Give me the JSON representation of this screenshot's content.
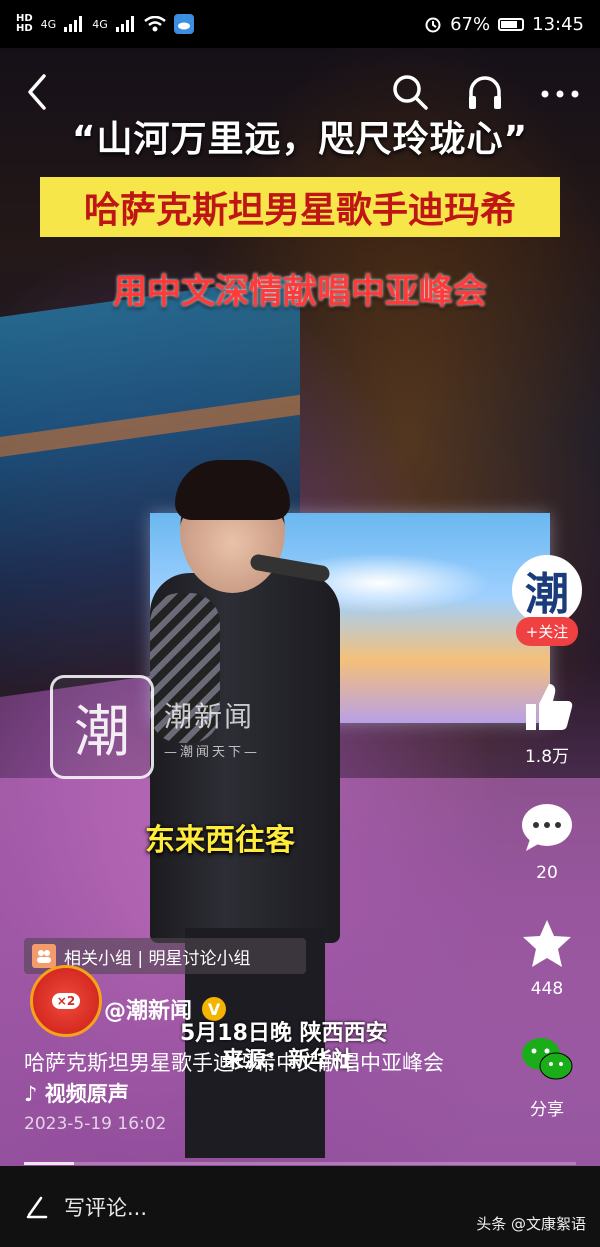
{
  "status_bar": {
    "hd1": "HD",
    "hd2": "HD",
    "signal1": "4G",
    "signal2": "4G",
    "battery": "67%",
    "time": "13:45"
  },
  "video": {
    "quote": "“山河万里远，咫尺玲珑心”",
    "headline": "哈萨克斯坦男星歌手迪玛希",
    "subline": "用中文深情献唱中亚峰会",
    "watermark_logo": "潮",
    "watermark_name": "潮新闻",
    "watermark_slogan": "—潮闻天下—",
    "caption_yellow": "东来西往客",
    "caption_white_1": "5月18日晚 陕西西安",
    "caption_white_2": "来源：新华社"
  },
  "side": {
    "avatar_text": "潮",
    "follow_label": "+关注",
    "like_count": "1.8万",
    "comment_count": "20",
    "favorite_count": "448",
    "share_label": "分享"
  },
  "info": {
    "group_label": "相关小组 | 明星讨论小组",
    "redpack_badge": "×2",
    "author_name": "@潮新闻",
    "description": "哈萨克斯坦男星歌手迪玛希中文献唱中亚峰会",
    "music_label": "♪ 视频原声",
    "date": "2023-5-19 16:02",
    "progress": 0.09
  },
  "bottom": {
    "comment_placeholder": "写评论...",
    "source_watermark": "头条 @文康絮语"
  },
  "colors": {
    "headline_bg": "#f7e64a",
    "headline_text": "#c01515",
    "follow_button": "#f04142",
    "caption_yellow": "#ffeb3b"
  }
}
